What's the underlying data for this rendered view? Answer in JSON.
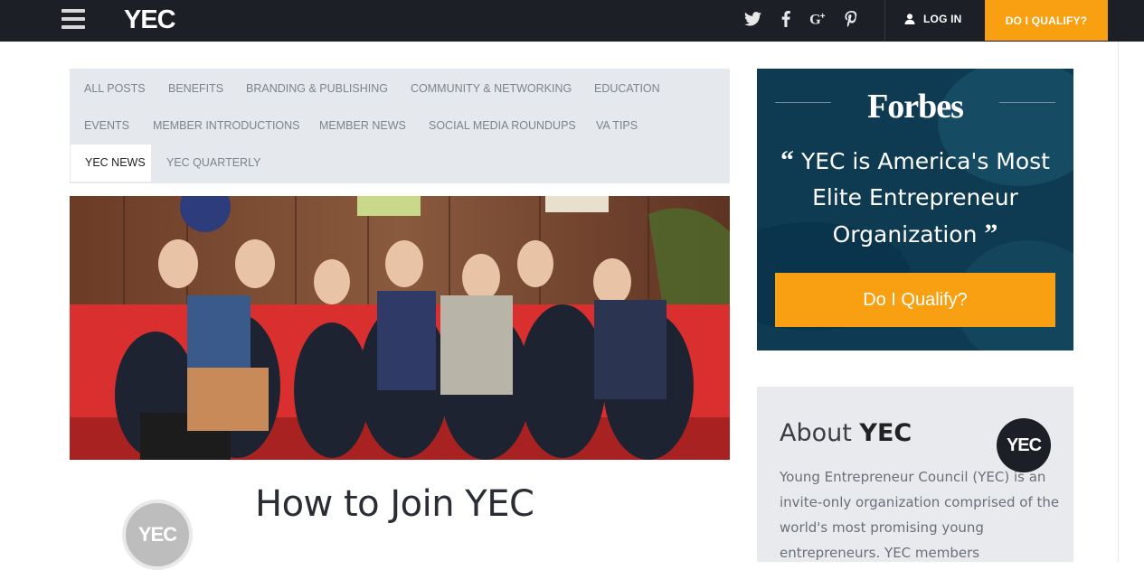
{
  "header": {
    "logo": "YEC",
    "login_label": "LOG IN",
    "qualify_label": "DO I QUALIFY?",
    "social_icons": [
      "twitter-icon",
      "facebook-icon",
      "google-plus-icon",
      "pinterest-icon"
    ]
  },
  "categories": [
    {
      "label": "ALL POSTS",
      "active": false
    },
    {
      "label": "BENEFITS",
      "active": false
    },
    {
      "label": "BRANDING & PUBLISHING",
      "active": false
    },
    {
      "label": "COMMUNITY & NETWORKING",
      "active": false
    },
    {
      "label": "EDUCATION",
      "active": false
    },
    {
      "label": "EVENTS",
      "active": false
    },
    {
      "label": "MEMBER INTRODUCTIONS",
      "active": false
    },
    {
      "label": "MEMBER NEWS",
      "active": false
    },
    {
      "label": "SOCIAL MEDIA ROUNDUPS",
      "active": false
    },
    {
      "label": "VA TIPS",
      "active": false
    },
    {
      "label": "YEC NEWS",
      "active": true
    },
    {
      "label": "YEC QUARTERLY",
      "active": false
    }
  ],
  "post": {
    "author_avatar": "YEC",
    "title": "How to Join YEC"
  },
  "forbes": {
    "brand": "Forbes",
    "quote": "YEC is America's Most Elite Entrepreneur Organization",
    "button_label": "Do I Qualify?"
  },
  "about": {
    "title_prefix": "About",
    "title_bold": "YEC",
    "logo": "YEC",
    "text": "Young Entrepreneur Council (YEC) is an invite-only organization comprised of the world's most promising young entrepreneurs. YEC members"
  },
  "colors": {
    "topbar": "#1c1f26",
    "accent_orange": "#f8a011",
    "category_bg": "#e5e8ec",
    "forbes_bg": "#0f3f55"
  }
}
